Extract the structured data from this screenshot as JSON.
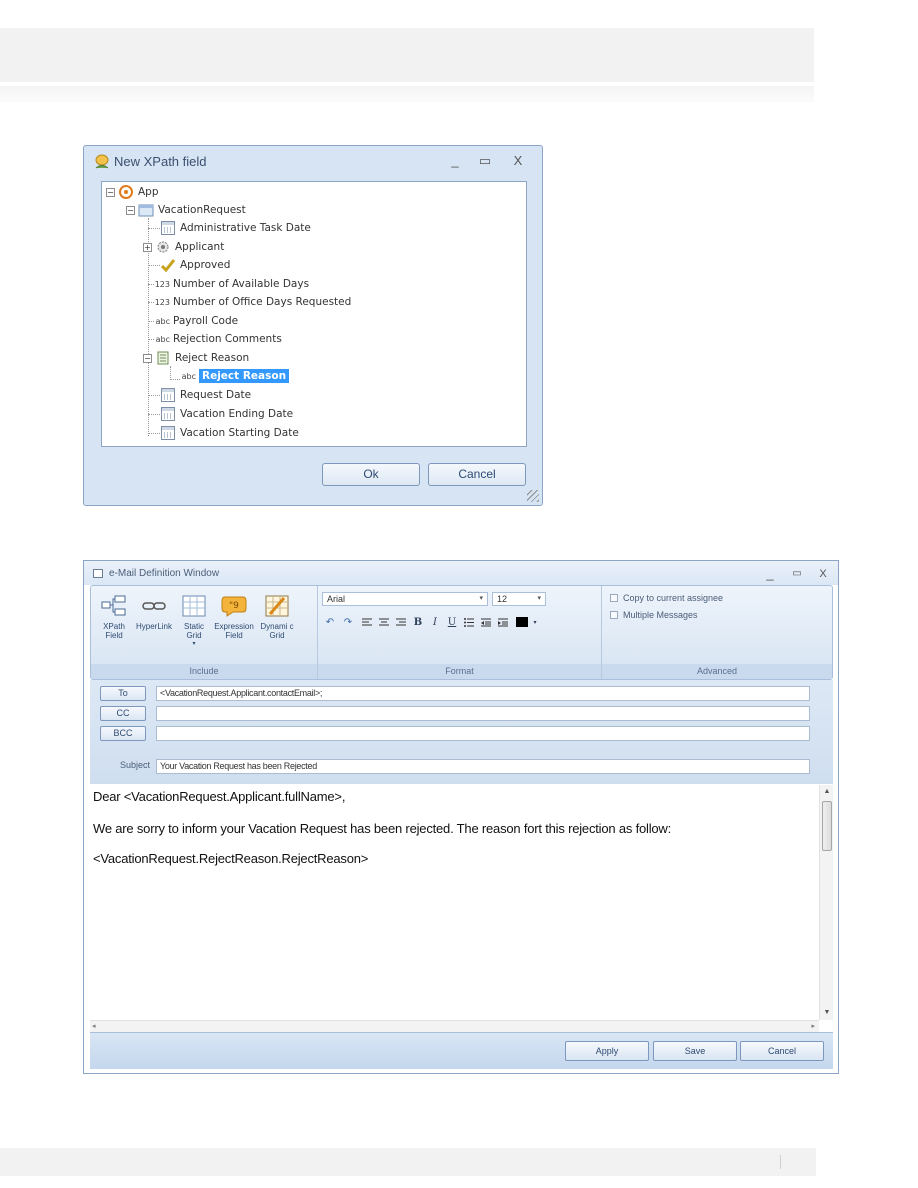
{
  "xpath_dialog": {
    "title": "New XPath field",
    "window_controls": {
      "minimize": "_",
      "maximize": "▭",
      "close": "X"
    },
    "tree": {
      "root": "App",
      "entity": "VacationRequest",
      "fields": [
        {
          "label": "Administrative Task Date",
          "type": "date"
        },
        {
          "label": "Applicant",
          "type": "entity"
        },
        {
          "label": "Approved",
          "type": "boolean"
        },
        {
          "label": "Number of Available Days",
          "type": "123"
        },
        {
          "label": "Number of Office Days Requested",
          "type": "123"
        },
        {
          "label": "Payroll Code",
          "type": "abc"
        },
        {
          "label": "Rejection Comments",
          "type": "abc"
        },
        {
          "label": "Reject Reason",
          "type": "entity"
        },
        {
          "label": "Reject Reason",
          "type": "abc",
          "selected": true
        },
        {
          "label": "Request Date",
          "type": "date"
        },
        {
          "label": "Vacation Ending Date",
          "type": "date"
        },
        {
          "label": "Vacation Starting Date",
          "type": "date"
        }
      ],
      "type_tags": {
        "number": "123",
        "text": "abc"
      }
    },
    "buttons": {
      "ok": "Ok",
      "cancel": "Cancel"
    }
  },
  "email_window": {
    "title": "e-Mail Definition Window",
    "window_controls": {
      "minimize": "_",
      "maximize": "▭",
      "close": "X"
    },
    "ribbon": {
      "include": {
        "label": "Include",
        "buttons": [
          {
            "label": "XPath Field",
            "icon": "xpath-field-icon"
          },
          {
            "label": "HyperLink",
            "icon": "hyperlink-icon"
          },
          {
            "label": "Static Grid",
            "icon": "static-grid-icon"
          },
          {
            "label": "Expression Field",
            "icon": "expression-field-icon"
          },
          {
            "label": "Dynami c Grid",
            "icon": "dynamic-grid-icon"
          }
        ]
      },
      "format": {
        "label": "Format",
        "font": "Arial",
        "size": "12",
        "dropdown_arrow": "▾",
        "tools": {
          "undo": "↶",
          "redo": "↷",
          "bold": "B",
          "italic": "I",
          "underline": "U",
          "color_arrow": "▾"
        }
      },
      "advanced": {
        "label": "Advanced",
        "options": [
          "Copy to current assignee",
          "Multiple Messages"
        ]
      }
    },
    "fields": {
      "to_label": "To",
      "to_value": "<VacationRequest.Applicant.contactEmail>;",
      "cc_label": "CC",
      "cc_value": "",
      "bcc_label": "BCC",
      "bcc_value": "",
      "subject_label": "Subject",
      "subject_value": "Your Vacation Request has been Rejected"
    },
    "body": {
      "line1": "Dear <VacationRequest.Applicant.fullName>,",
      "line2": "We are sorry to inform your Vacation Request has been rejected. The reason fort this rejection as follow:",
      "line3": "<VacationRequest.RejectReason.RejectReason>"
    },
    "scroll_arrows": {
      "up": "▲",
      "down": "▼",
      "left": "◂",
      "right": "▸"
    },
    "buttons": {
      "apply": "Apply",
      "save": "Save",
      "cancel": "Cancel"
    }
  }
}
